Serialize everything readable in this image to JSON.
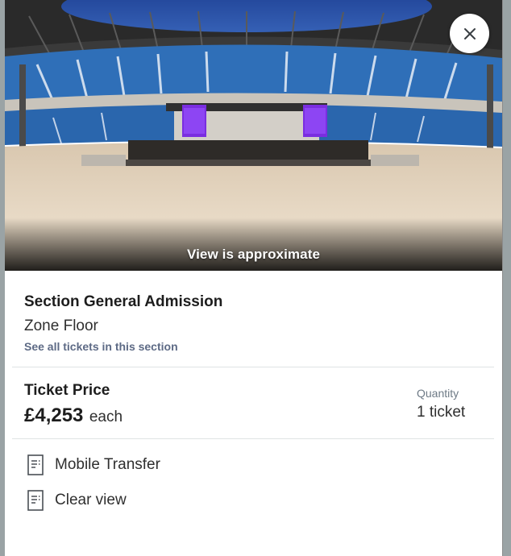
{
  "hero": {
    "caption": "View is approximate",
    "close_icon": "close-icon"
  },
  "section": {
    "title": "Section General Admission",
    "zone": "Zone Floor",
    "see_all_link": "See all tickets in this section"
  },
  "price": {
    "label": "Ticket Price",
    "value": "£4,253",
    "suffix": "each"
  },
  "quantity": {
    "label": "Quantity",
    "value": "1 ticket"
  },
  "features": [
    {
      "icon": "document-list-icon",
      "label": "Mobile Transfer"
    },
    {
      "icon": "document-list-icon",
      "label": "Clear view"
    }
  ],
  "colors": {
    "link": "#5d6a85",
    "seats": "#2f6fb8",
    "stage_screens": "#7a2ee0",
    "floor": "#e6d7c2"
  }
}
